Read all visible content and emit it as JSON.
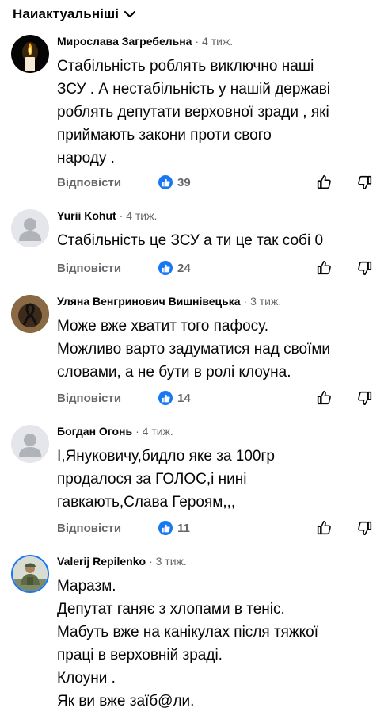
{
  "sort": {
    "label": "Наиактуальніші",
    "icon": "chevron-down-icon"
  },
  "ui": {
    "reply_label": "Відповісти",
    "like_icon": "thumbs-up-icon",
    "upvote_icon": "arrow-up-icon",
    "downvote_icon": "arrow-down-icon",
    "like_color": "#1877f2"
  },
  "comments": [
    {
      "author": "Мирослава Загребельна",
      "time": "· 4 тиж.",
      "text": "Стабільність роблять виключно наші\nЗСУ . А нестабільність у нашій державі\nроблять депутати верховної зради , які\nприймають закони проти свого\nнароду .",
      "reply": "Відповісти",
      "likes": "39",
      "avatar": "candle-avatar"
    },
    {
      "author": "Yurii Kohut",
      "time": "· 4 тиж.",
      "text": "Стабільність це ЗСУ а ти це так собі 0",
      "reply": "Відповісти",
      "likes": "24",
      "avatar": "default-avatar"
    },
    {
      "author": "Уляна Венгринович Вишнівецька",
      "time": "· 3 тиж.",
      "text": "Може вже хватит того пафосу.\nМожливо варто задуматися над своїми\nсловами, а не бути в ролі клоуна.",
      "reply": "Відповісти",
      "likes": "14",
      "avatar": "ribbon-avatar"
    },
    {
      "author": "Богдан Огонь",
      "time": "· 4 тиж.",
      "text": "І,Януковичу,бидло яке за 100гр\nпродалося за ГОЛОС,і нині\nгавкають,Слава Героям,,,",
      "reply": "Відповісти",
      "likes": "11",
      "avatar": "default-avatar"
    },
    {
      "author": "Valerij Repilenko",
      "time": "· 3 тиж.",
      "text": "Маразм.\nДепутат ганяє з хлопами в теніс.\nМабуть вже на канікулах після тяжкої\nпраці в верховній зраді.\nКлоуни .\nЯк ви вже заїб@ли.",
      "avatar": "soldier-avatar"
    }
  ]
}
